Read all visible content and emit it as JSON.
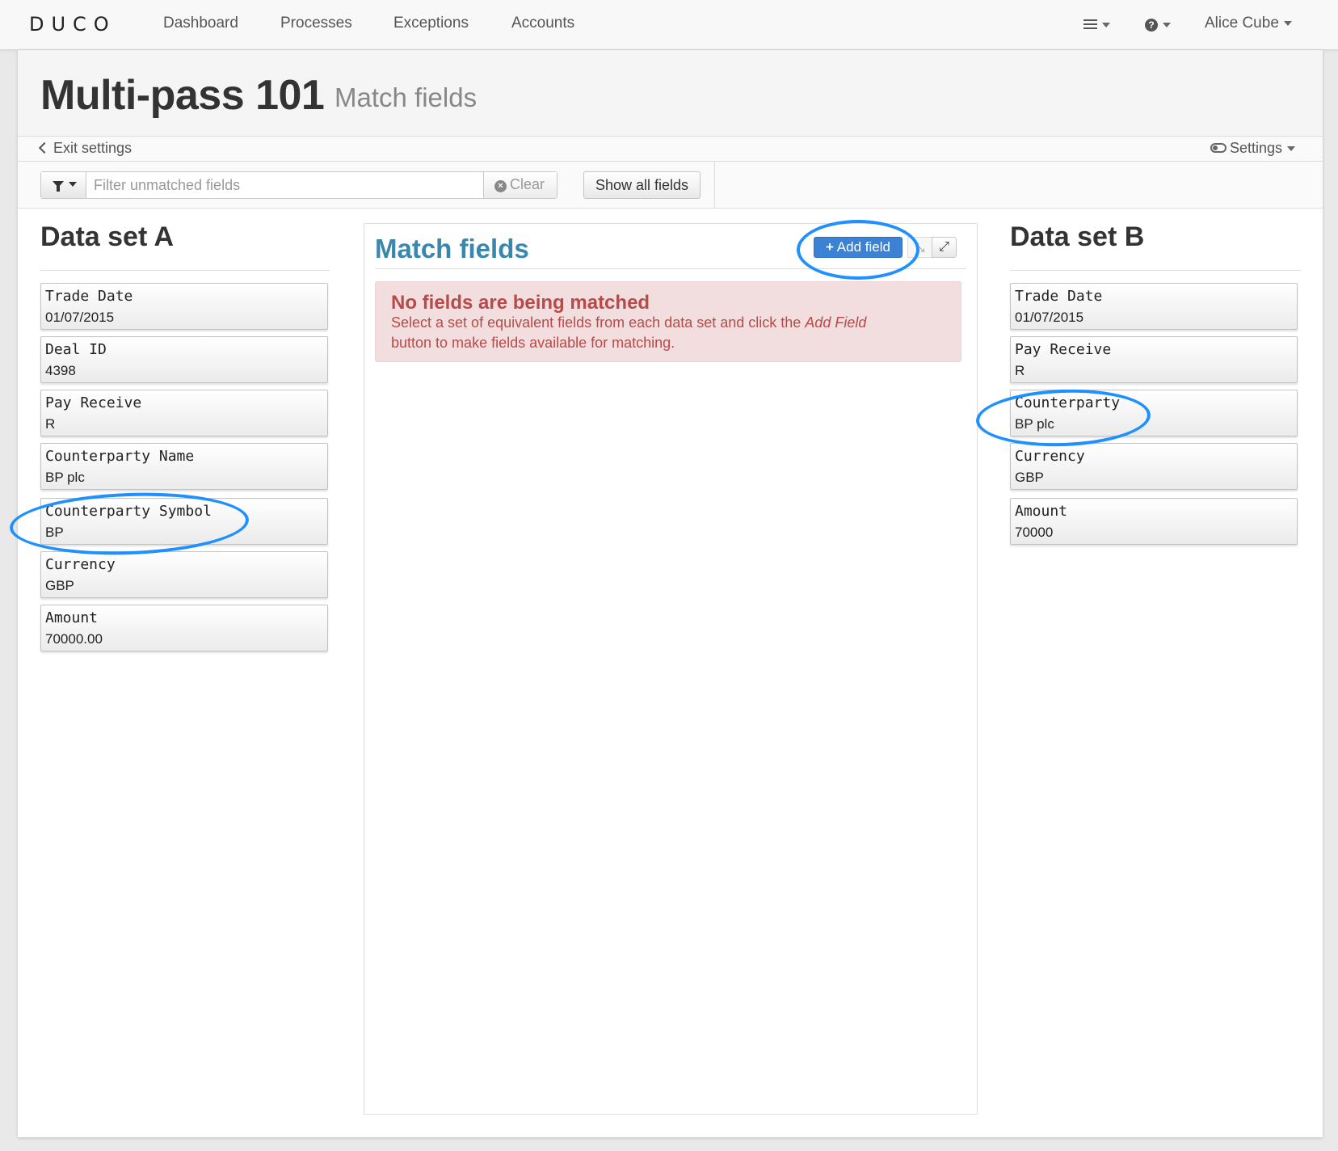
{
  "nav": {
    "logo": "DUCO",
    "items": [
      "Dashboard",
      "Processes",
      "Exceptions",
      "Accounts"
    ],
    "menu_icon": "hamburger-icon",
    "help_icon": "question-circle-icon",
    "user": "Alice Cube"
  },
  "page": {
    "title": "Multi-pass 101",
    "subtitle": "Match fields"
  },
  "settings_bar": {
    "exit_label": "Exit settings",
    "settings_label": "Settings"
  },
  "filter": {
    "placeholder": "Filter unmatched fields",
    "clear_label": "Clear",
    "show_all_label": "Show all fields"
  },
  "dataset_a": {
    "heading": "Data set A",
    "fields": [
      {
        "name": "Trade Date",
        "value": "01/07/2015"
      },
      {
        "name": "Deal ID",
        "value": "4398"
      },
      {
        "name": "Pay Receive",
        "value": "R"
      },
      {
        "name": "Counterparty Name",
        "value": "BP plc"
      },
      {
        "name": "Counterparty Symbol",
        "value": "BP"
      },
      {
        "name": "Currency",
        "value": "GBP"
      },
      {
        "name": "Amount",
        "value": "70000.00"
      }
    ]
  },
  "match": {
    "heading": "Match fields",
    "add_label": "Add field",
    "alert_title": "No fields are being matched",
    "alert_line1_pre": "Select a set of equivalent fields from each data set and click the ",
    "alert_line1_em": "Add Field",
    "alert_line2": "button to make fields available for matching."
  },
  "dataset_b": {
    "heading": "Data set B",
    "fields": [
      {
        "name": "Trade Date",
        "value": "01/07/2015"
      },
      {
        "name": "Pay Receive",
        "value": "R"
      },
      {
        "name": "Counterparty",
        "value": "BP plc"
      },
      {
        "name": "Currency",
        "value": "GBP"
      },
      {
        "name": "Amount",
        "value": "70000"
      }
    ]
  },
  "colors": {
    "accent": "#3a87ad",
    "primary_button": "#3b82d4",
    "alert_text": "#b94a48",
    "alert_bg": "#f2dede",
    "annotation": "#1e90ff"
  }
}
